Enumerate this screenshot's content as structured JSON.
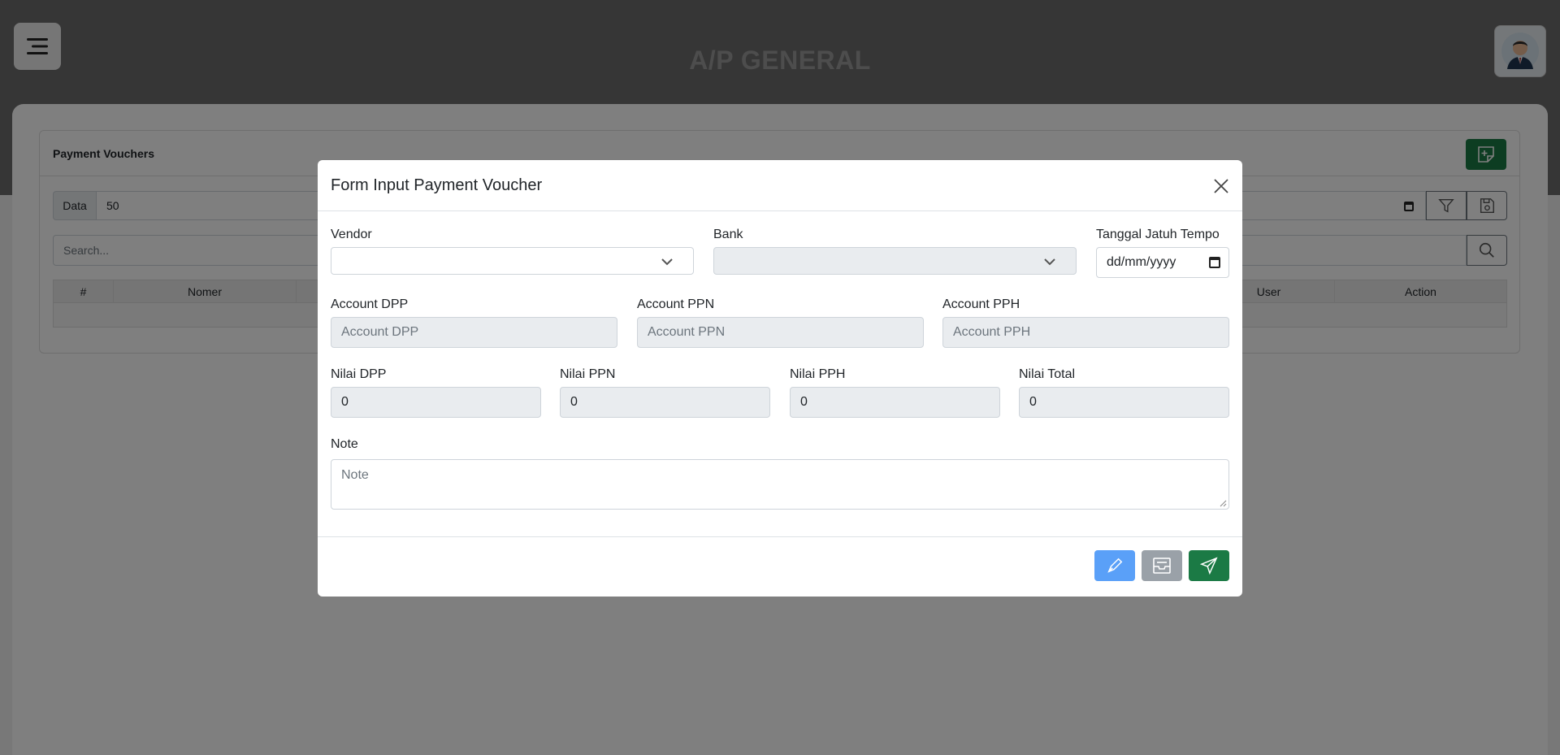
{
  "app": {
    "title": "A/P GENERAL",
    "menu_icon": "menu-icon",
    "avatar_icon": "user-avatar"
  },
  "card": {
    "title": "Payment Vouchers",
    "data_label": "Data",
    "data_value": "50",
    "search_placeholder": "Search...",
    "columns": [
      "#",
      "Nomer",
      "",
      "User",
      "Action"
    ]
  },
  "modal": {
    "title": "Form Input Payment Voucher",
    "vendor": {
      "label": "Vendor",
      "value": ""
    },
    "bank": {
      "label": "Bank",
      "value": ""
    },
    "due_date": {
      "label": "Tanggal Jatuh Tempo",
      "placeholder": "dd/mm/yyyy"
    },
    "account_dpp": {
      "label": "Account DPP",
      "placeholder": "Account DPP"
    },
    "account_ppn": {
      "label": "Account PPN",
      "placeholder": "Account PPN"
    },
    "account_pph": {
      "label": "Account PPH",
      "placeholder": "Account PPH"
    },
    "nilai_dpp": {
      "label": "Nilai DPP",
      "value": "0"
    },
    "nilai_ppn": {
      "label": "Nilai PPN",
      "value": "0"
    },
    "nilai_pph": {
      "label": "Nilai PPH",
      "value": "0"
    },
    "nilai_total": {
      "label": "Nilai Total",
      "value": "0"
    },
    "note": {
      "label": "Note",
      "placeholder": "Note"
    }
  },
  "colors": {
    "primary_green": "#1b7a45",
    "blue": "#5aa0f8",
    "gray": "#9aa1a8",
    "overlay": "rgba(0,0,0,0.5)"
  }
}
